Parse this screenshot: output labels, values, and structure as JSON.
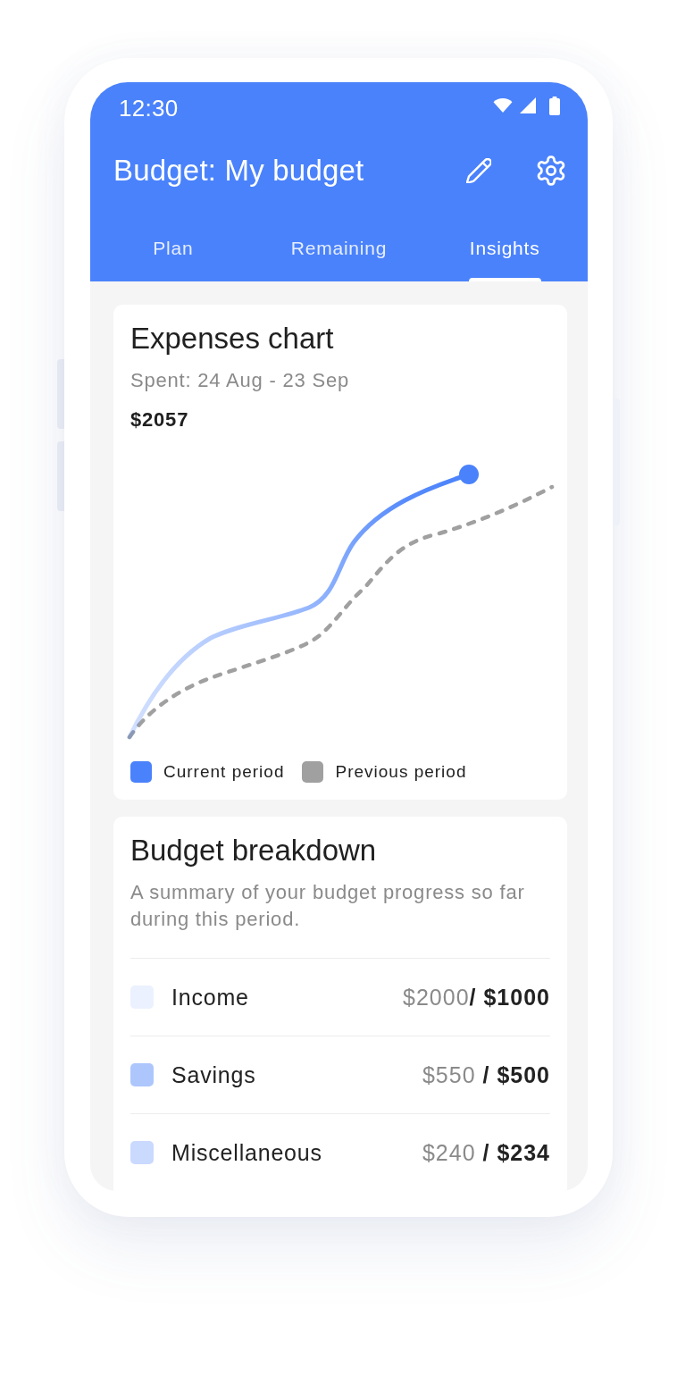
{
  "status_bar": {
    "time": "12:30"
  },
  "header": {
    "title": "Budget: My budget"
  },
  "tabs": [
    {
      "label": "Plan",
      "selected": false
    },
    {
      "label": "Remaining",
      "selected": false
    },
    {
      "label": "Insights",
      "selected": true
    }
  ],
  "expenses_chart": {
    "title": "Expenses chart",
    "subtitle": "Spent: 24 Aug - 23 Sep",
    "total": "$2057",
    "legend": [
      {
        "label": "Current period",
        "color": "#4a82fb"
      },
      {
        "label": "Previous period",
        "color": "#a0a0a0"
      }
    ]
  },
  "budget_breakdown": {
    "title": "Budget breakdown",
    "description": "A summary of your budget progress so far during this period.",
    "rows": [
      {
        "label": "Income",
        "amount": "$2000**/ $1000**",
        "color": "#ebf1fe"
      },
      {
        "label": "Savings",
        "amount": "$550 **/ $500**",
        "color": "#adc7fd"
      },
      {
        "label": "Miscellaneous",
        "amount": "$240 **/ $234**",
        "color": "#cad9fe"
      }
    ]
  }
}
